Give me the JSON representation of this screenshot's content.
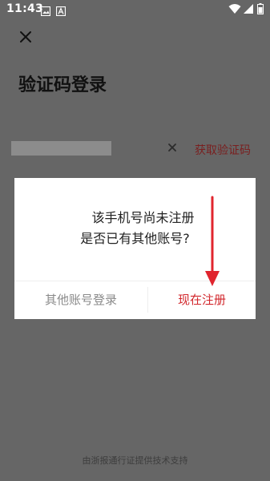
{
  "status_bar": {
    "time": "11:43",
    "left_icons": [
      "image-icon",
      "text-a-icon"
    ],
    "right_icons": [
      "wifi-icon",
      "signal-icon",
      "battery-icon"
    ]
  },
  "page": {
    "title": "验证码登录",
    "close_icon": "close-icon",
    "phone_input_value": "",
    "clear_icon": "clear-icon",
    "get_code_label": "获取验证码",
    "footer": "由浙报通行证提供技术支持"
  },
  "dialog": {
    "line1": "该手机号尚未注册",
    "line2": "是否已有其他账号?",
    "other_account_label": "其他账号登录",
    "register_label": "现在注册"
  },
  "colors": {
    "overlay_background": "#666666",
    "accent_red": "#d2272c",
    "arrow_red": "#e0252e"
  }
}
